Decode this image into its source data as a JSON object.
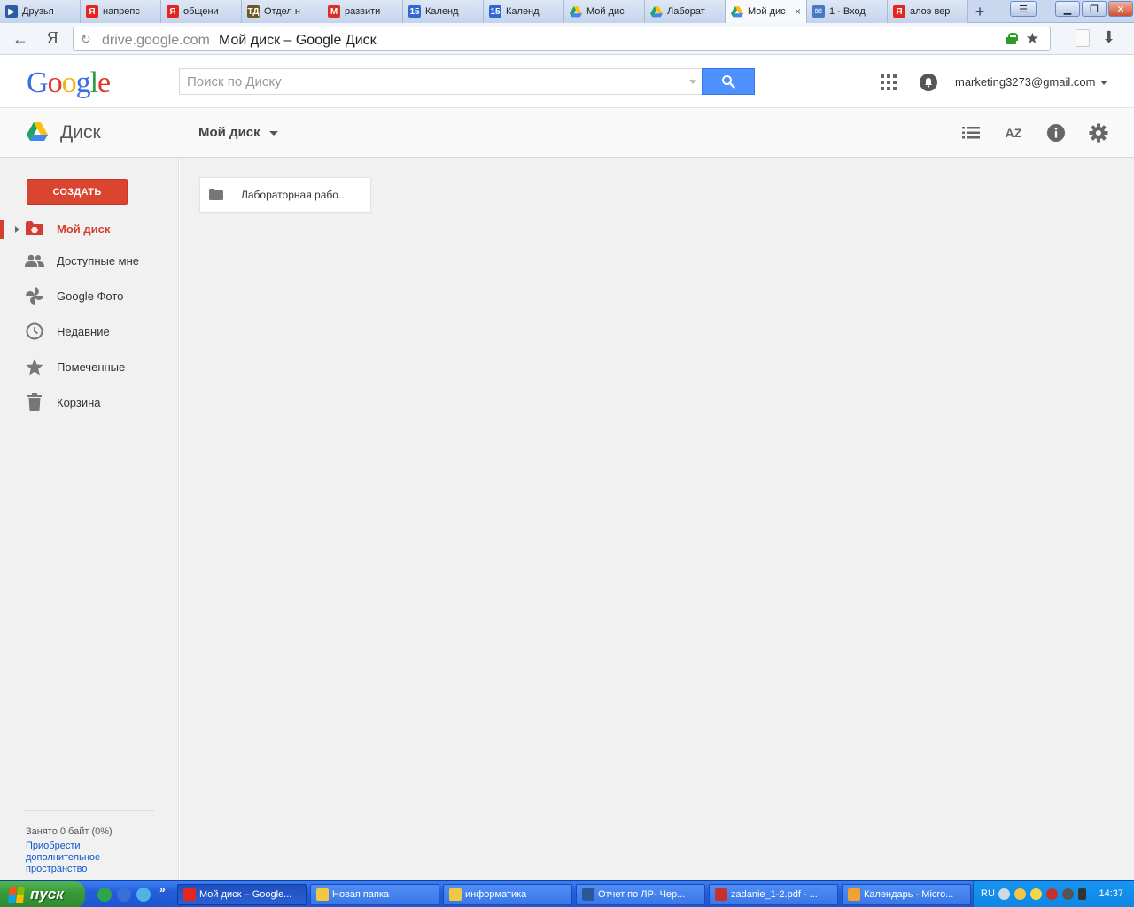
{
  "browser": {
    "tabs": [
      {
        "label": "Друзья",
        "fav": "▶",
        "color": "#2c5ca8"
      },
      {
        "label": "напрепс",
        "fav": "Я",
        "color": "#e52620"
      },
      {
        "label": "общени",
        "fav": "Я",
        "color": "#e52620"
      },
      {
        "label": "Отдел н",
        "fav": "ТД",
        "color": "#6b5a1e"
      },
      {
        "label": "развити",
        "fav": "M",
        "color": "#d93025"
      },
      {
        "label": "Календ",
        "fav": "15",
        "color": "#3367d6"
      },
      {
        "label": "Календ",
        "fav": "15",
        "color": "#3367d6"
      },
      {
        "label": "Мой дис",
        "fav": "drive",
        "color": "#1fa463"
      },
      {
        "label": "Лаборат",
        "fav": "drive",
        "color": "#1fa463"
      },
      {
        "label": "Мой дис",
        "fav": "drive",
        "color": "#1fa463",
        "active": true
      },
      {
        "label": "1 · Вход",
        "fav": "✉",
        "color": "#4a78c8"
      },
      {
        "label": "алоэ вер",
        "fav": "Я",
        "color": "#e52620"
      }
    ],
    "tab_close": "×",
    "new_tab": "+",
    "back": "←",
    "brand": "Я",
    "reload": "↻",
    "url_host": "drive.google.com",
    "url_title": "Мой диск – Google Диск",
    "bookmark_star": "★",
    "download": "⬇"
  },
  "header": {
    "search_placeholder": "Поиск по Диску",
    "account": "marketing3273@gmail.com"
  },
  "toolbar": {
    "app_name": "Диск",
    "location": "Мой диск",
    "sort_label": "AZ"
  },
  "sidebar": {
    "create_label": "СОЗДАТЬ",
    "items": [
      {
        "label": "Мой диск",
        "icon": "my-drive-icon",
        "active": true
      },
      {
        "label": "Доступные мне",
        "icon": "shared-icon"
      },
      {
        "label": "Google Фото",
        "icon": "photos-icon"
      },
      {
        "label": "Недавние",
        "icon": "clock-icon"
      },
      {
        "label": "Помеченные",
        "icon": "star-icon"
      },
      {
        "label": "Корзина",
        "icon": "trash-icon"
      }
    ],
    "quota": "Занято 0 байт (0%)",
    "buy_more": "Приобрести дополнительное пространство"
  },
  "content": {
    "folders": [
      {
        "name": "Лабораторная рабо..."
      }
    ]
  },
  "taskbar": {
    "start_label": "пуск",
    "more": "»",
    "tasks": [
      {
        "label": "Мой диск – Google...",
        "active": true,
        "color": "#e52620"
      },
      {
        "label": "Новая папка",
        "color": "#f2c744"
      },
      {
        "label": "информатика",
        "color": "#f2c744"
      },
      {
        "label": "Отчет по ЛР- Чер...",
        "color": "#2b5797"
      },
      {
        "label": "zadanie_1-2.pdf - ...",
        "color": "#c9302c"
      },
      {
        "label": "Календарь - Micro...",
        "color": "#f2a134"
      }
    ],
    "lang": "RU",
    "clock": "14:37"
  }
}
